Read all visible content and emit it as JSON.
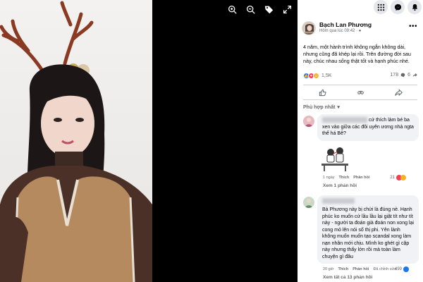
{
  "photo": {
    "toolbar": {
      "zoom_in_icon": "zoom-in-icon",
      "zoom_out_icon": "zoom-out-icon",
      "tag_icon": "tag-icon",
      "fullscreen_icon": "fullscreen-icon"
    }
  },
  "topbar": {
    "icons": [
      "menu-grid-icon",
      "messenger-icon",
      "notification-bell-icon"
    ]
  },
  "post": {
    "author": "Bạch Lan Phương",
    "time": "Hôm qua lúc 09:42 · ",
    "text": "4 năm, một hành trình không ngắn không dài, nhưng cũng đã khép lại rồi. Trên đường đời sau này, chúc nhau sống thật tốt và hạnh phúc nhé.",
    "reaction_count": "1,5K",
    "comment_count": "178",
    "share_count": "6",
    "actions": [
      "like-icon",
      "comment-icon",
      "share-icon"
    ],
    "sort_label": "Phù hợp nhất"
  },
  "comments": [
    {
      "text": " cứ thích làm bé ba xen vào giữa các đôi uyên ương nhà ngta thế há Bê?",
      "time": "1 ngày",
      "like_label": "Thích",
      "reply_label": "Phản hồi",
      "react_count": "21",
      "view_replies": "Xem 1 phản hồi"
    },
    {
      "text": "Bà Phương này bị chửi là đúng nè. Hạnh phúc ko muốn cứ lầu lầu lại giật tít như tít này - người ta đoán già đoán non xong lại cong mỏ lên nói số thị phi. Yên lành không muốn muốn tạo scandal xong làm nạn nhân mới chịu. Mình ko ghét gì cặp này nhưng thấy lớn rồi mà toàn làm chuyện gì đâu",
      "time": "20 giờ",
      "like_label": "Thích",
      "reply_label": "Phản hồi",
      "edited_label": "Đã chỉnh sửa",
      "react_count": "499",
      "view_replies": "Xem tất cả 13 phản hồi"
    }
  ]
}
